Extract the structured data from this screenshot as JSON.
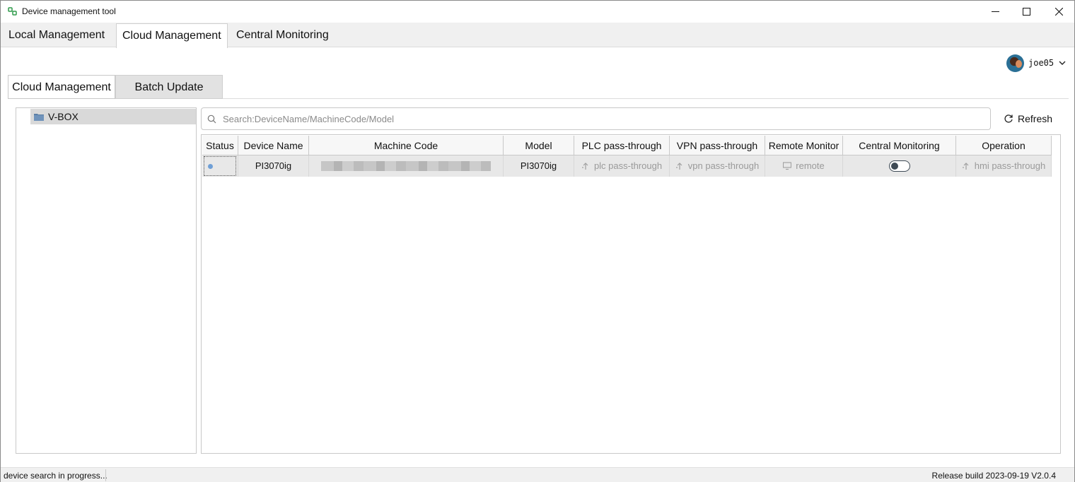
{
  "window": {
    "title": "Device management tool",
    "controls": {
      "minimize": "minimize",
      "maximize": "maximize",
      "close": "close"
    }
  },
  "main_tabs": [
    {
      "label": "Local Management",
      "active": false
    },
    {
      "label": "Cloud Management",
      "active": true
    },
    {
      "label": "Central Monitoring",
      "active": false
    }
  ],
  "user": {
    "name": "joe05",
    "icon": "chevron-down-icon"
  },
  "sub_tabs": [
    {
      "label": "Cloud Management",
      "active": true
    },
    {
      "label": "Batch Update",
      "active": false
    }
  ],
  "tree": {
    "items": [
      {
        "label": "V-BOX",
        "icon": "folder-icon"
      }
    ]
  },
  "search": {
    "placeholder": "Search:DeviceName/MachineCode/Model",
    "value": ""
  },
  "refresh": {
    "label": "Refresh"
  },
  "table": {
    "columns": [
      "Status",
      "Device Name",
      "Machine Code",
      "Model",
      "PLC pass-through",
      "VPN pass-through",
      "Remote Monitor",
      "Central Monitoring",
      "Operation"
    ],
    "rows": [
      {
        "status": "online-dot",
        "device_name": "PI3070ig",
        "machine_code_redacted": true,
        "model": "PI3070ig",
        "plc": "plc pass-through",
        "vpn": "vpn pass-through",
        "remote": "remote",
        "central_monitoring_enabled": false,
        "operation": "hmi pass-through"
      }
    ]
  },
  "statusbar": {
    "left": "device search in progress...",
    "right": "Release build 2023-09-19 V2.0.4"
  },
  "colors": {
    "status_dot": "#6f9fd6",
    "selected_row": "#e8e8e8",
    "tree_selected": "#d9d9d9",
    "folder": "#5b7fa6"
  }
}
